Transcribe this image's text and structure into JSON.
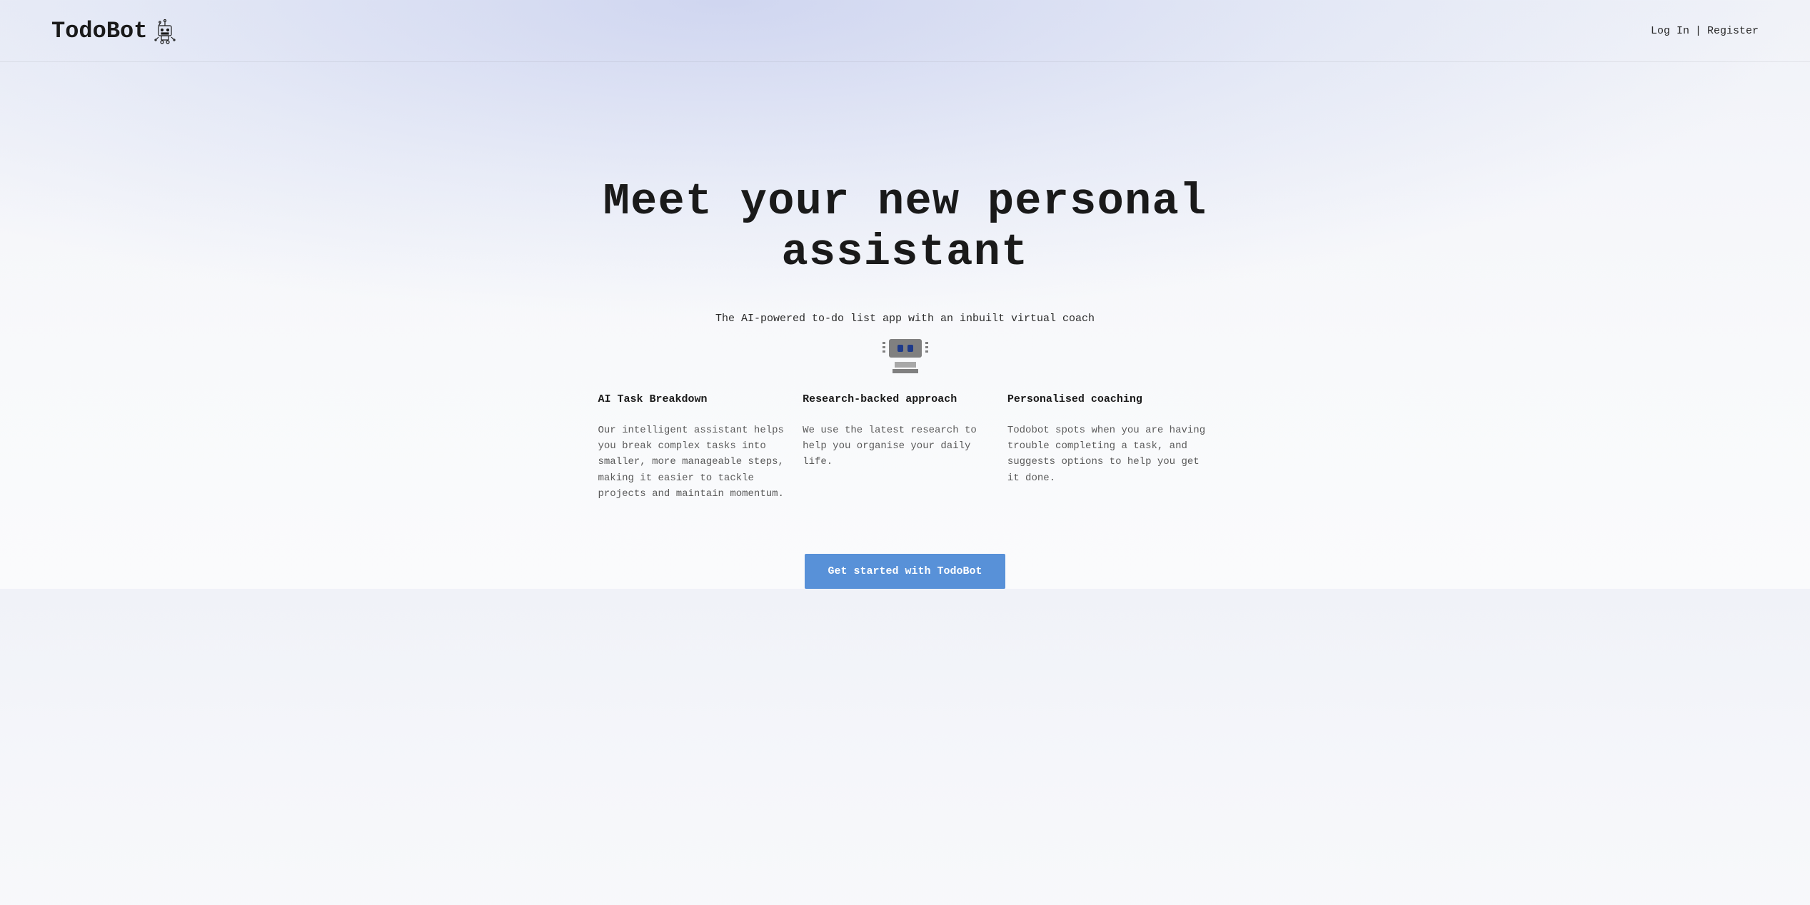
{
  "header": {
    "logo_text": "TodoBot",
    "login_label": "Log In",
    "register_label": "Register",
    "separator": "|"
  },
  "hero": {
    "title": "Meet your new personal assistant",
    "subtitle": "The AI-powered to-do list app with an inbuilt virtual coach"
  },
  "features": [
    {
      "title": "AI Task Breakdown",
      "description": "Our intelligent assistant helps you break complex tasks into smaller, more manageable steps, making it easier to tackle projects and maintain momentum."
    },
    {
      "title": "Research-backed approach",
      "description": "We use the latest research to help you organise your daily life."
    },
    {
      "title": "Personalised coaching",
      "description": "Todobot spots when you are having trouble completing a task, and suggests options to help you get it done."
    }
  ],
  "cta": {
    "button_label": "Get started with TodoBot"
  }
}
